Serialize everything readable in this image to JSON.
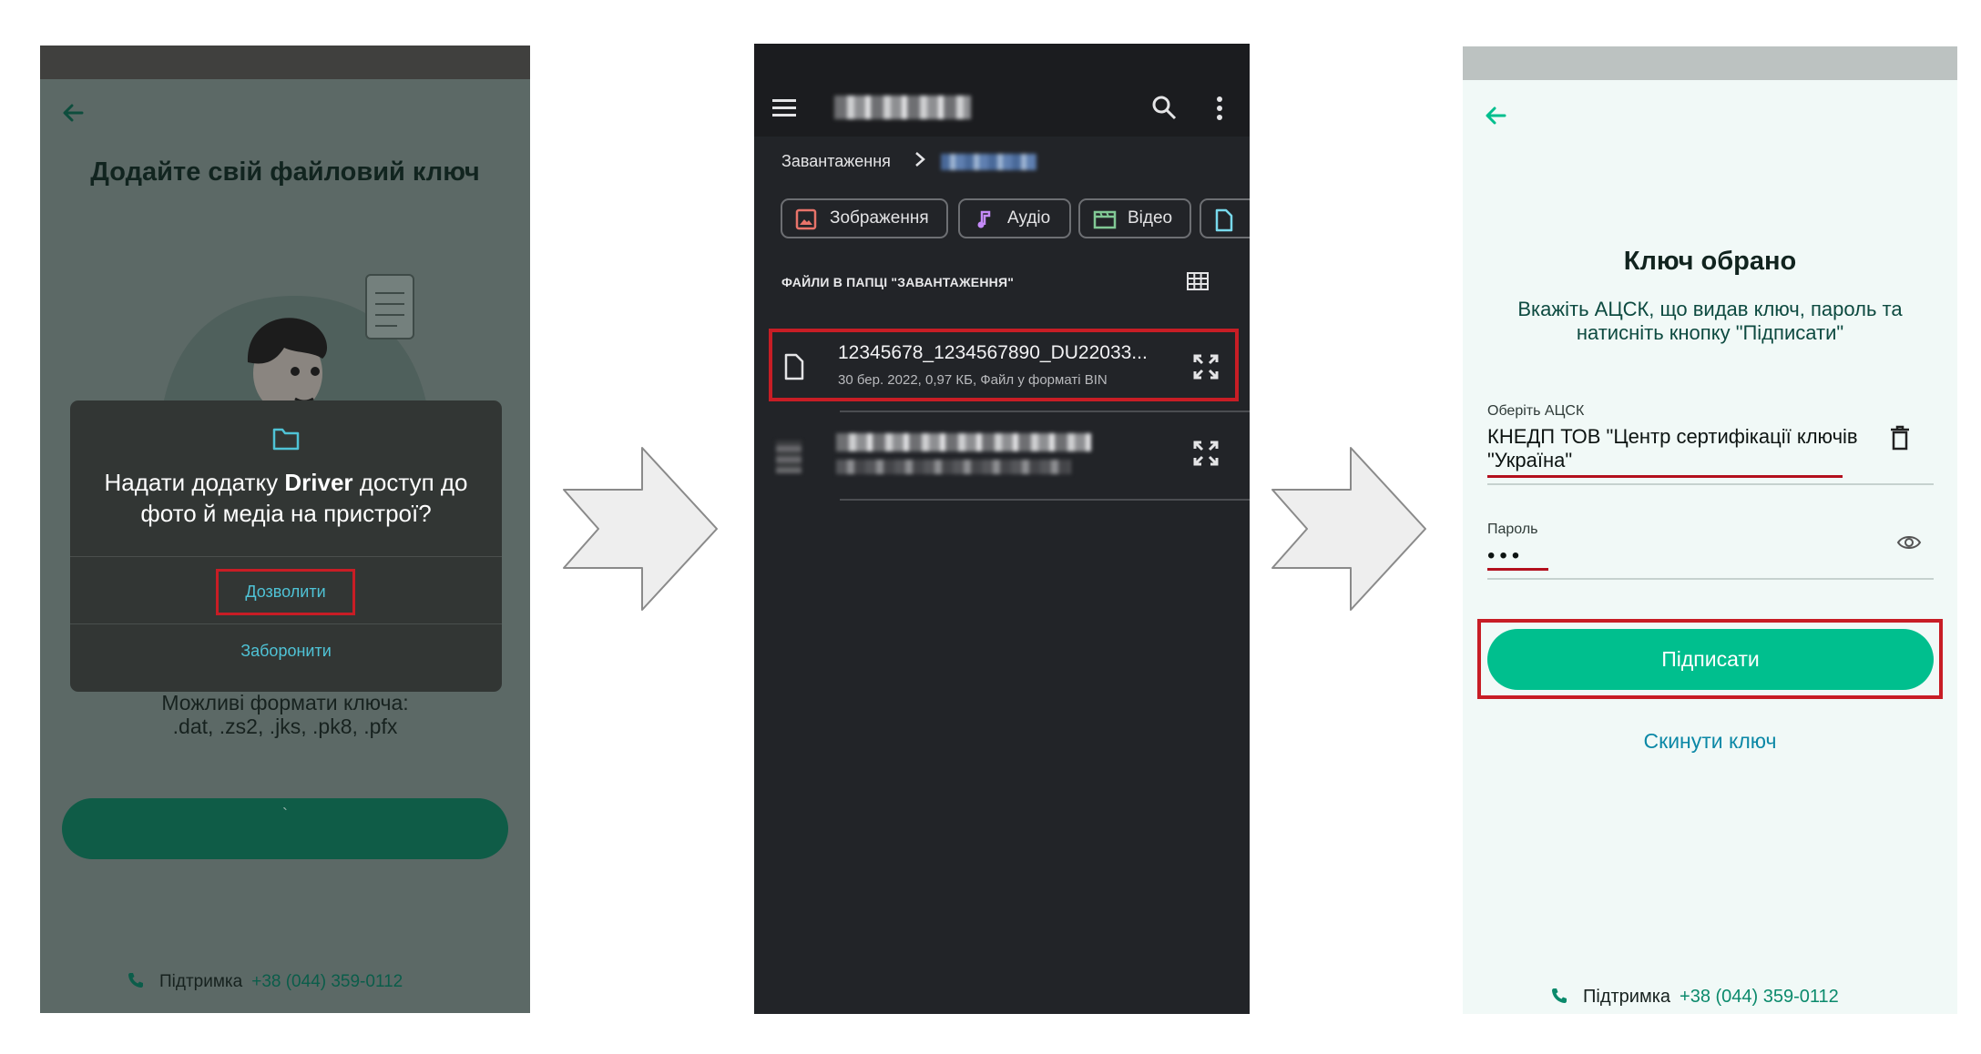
{
  "screen1": {
    "title": "Додайте свій файловий ключ",
    "formats_label": "Можливі формати ключа:",
    "formats_list": ".dat, .zs2, .jks, .pk8, .pfx",
    "support_label": "Підтримка",
    "support_phone": "+38 (044) 359-0112",
    "dialog": {
      "question_prefix": "Надати додатку",
      "app_name": "Driver",
      "question_suffix": "доступ до фото й медіа на пристрої?",
      "allow_label": "Дозволити",
      "deny_label": "Заборонити"
    }
  },
  "screen2": {
    "breadcrumb": "Завантаження",
    "chips": [
      "Зображення",
      "Аудіо",
      "Відео"
    ],
    "section_title": "ФАЙЛИ В ПАПЦІ \"ЗАВАНТАЖЕННЯ\"",
    "file": {
      "name": "12345678_1234567890_DU22033...",
      "meta": "30 бер. 2022, 0,97 КБ, Файл у форматі BIN"
    }
  },
  "screen3": {
    "title": "Ключ обрано",
    "subtitle": "Вкажіть АЦСК, що видав ключ, пароль та натисніть кнопку \"Підписати\"",
    "acsk_label": "Оберіть АЦСК",
    "acsk_value": "КНЕДП ТОВ \"Центр сертифікації ключів \"Україна\"",
    "password_label": "Пароль",
    "password_value": "•••",
    "sign_button": "Підписати",
    "reset_link": "Скинути ключ",
    "support_label": "Підтримка",
    "support_phone": "+38 (044) 359-0112"
  },
  "colors": {
    "accent_green": "#00bf8e",
    "highlight_red": "#c81d25",
    "link_blue": "#0b88a6"
  }
}
